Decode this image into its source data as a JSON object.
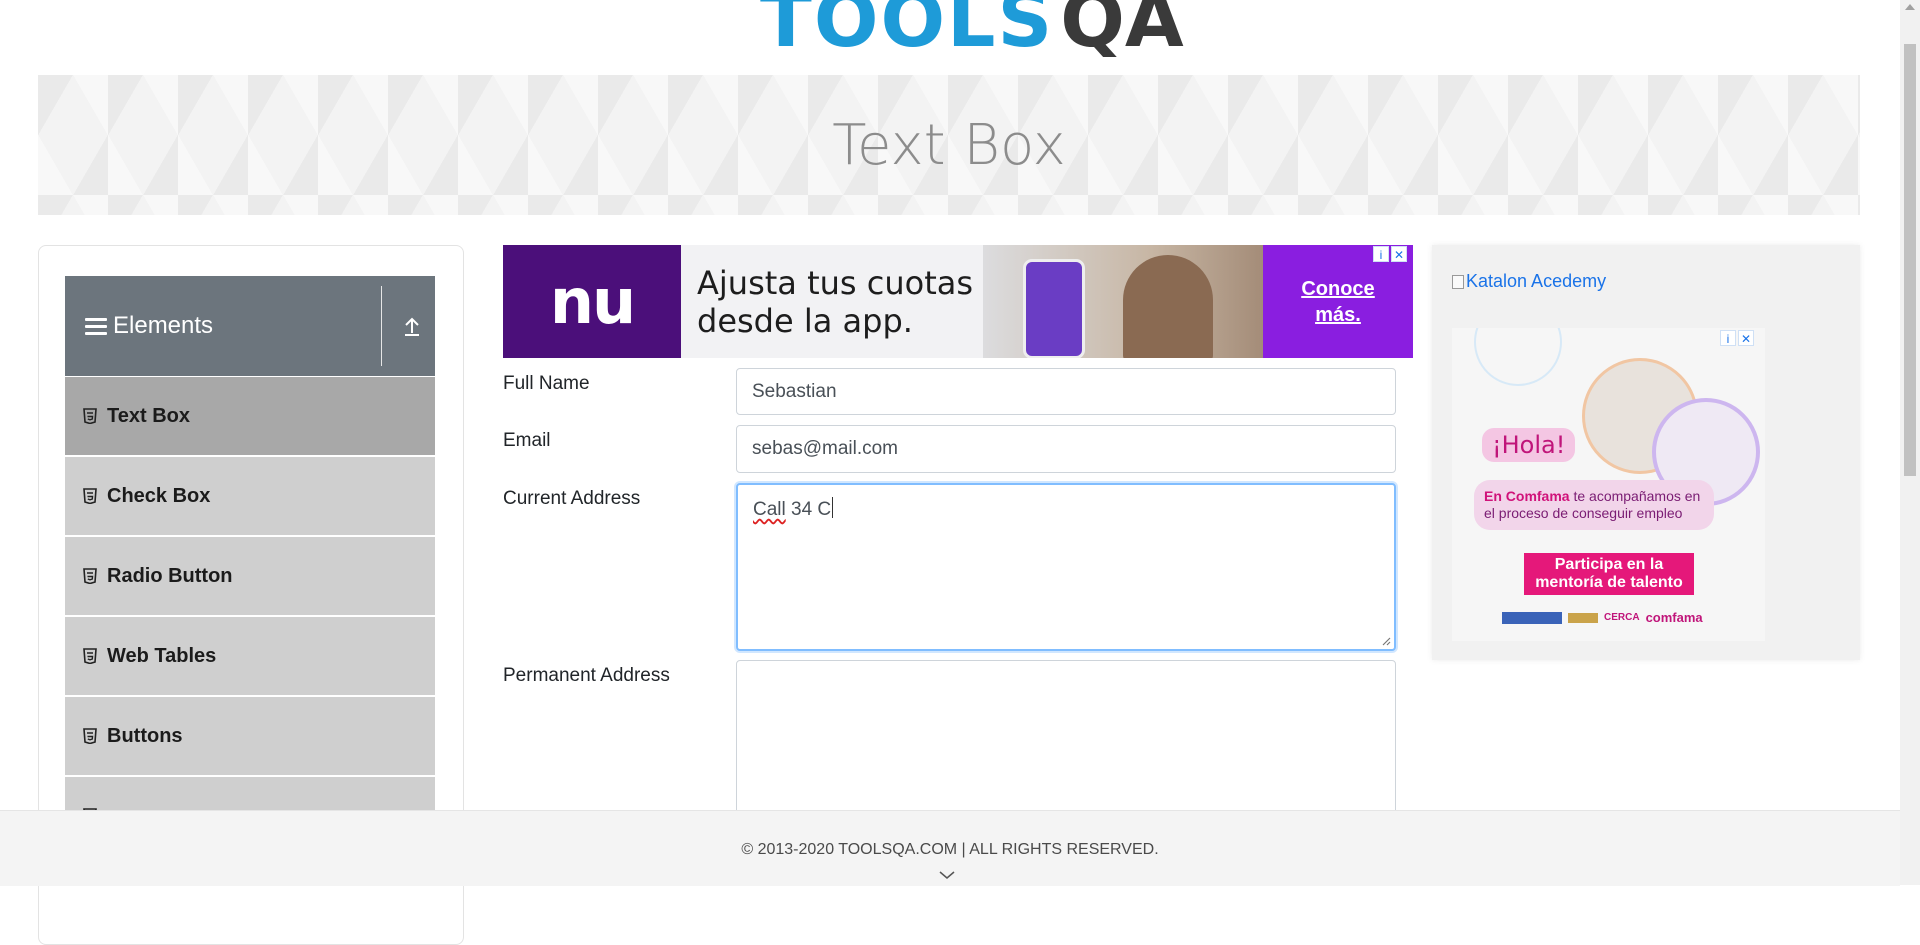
{
  "header": {
    "logo_text": "TOOLS",
    "logo_text_2": "QA",
    "page_title": "Text Box"
  },
  "sidebar": {
    "group_title": "Elements",
    "items": [
      {
        "label": "Text Box",
        "active": true
      },
      {
        "label": "Check Box"
      },
      {
        "label": "Radio Button"
      },
      {
        "label": "Web Tables"
      },
      {
        "label": "Buttons"
      }
    ]
  },
  "ad_top": {
    "brand": "nu",
    "message_line1": "Ajusta tus cuotas",
    "message_line2": "desde la app.",
    "cta_line1": "Conoce",
    "cta_line2": "más."
  },
  "form": {
    "full_name_label": "Full Name",
    "full_name_value": "Sebastian",
    "email_label": "Email",
    "email_value": "sebas@mail.com",
    "current_address_label": "Current Address",
    "current_address_word1": "Call",
    "current_address_rest": " 34 C",
    "permanent_address_label": "Permanent Address",
    "permanent_address_value": ""
  },
  "ad_right": {
    "alt_text": "Katalon Acedemy",
    "greeting": "¡Hola!",
    "body_bold": "En Comfama",
    "body_rest": " te acompañamos en el proceso de conseguir empleo",
    "button_line1": "Participa en la",
    "button_line2": "mentoría de talento",
    "brand": "comfama",
    "sponsor_label": "CERCA"
  },
  "footer": {
    "copyright": "© 2013-2020 TOOLSQA.COM | ALL RIGHTS RESERVED."
  },
  "colors": {
    "accent": "#1e9bd8",
    "header_gray": "#6c757d",
    "active_item": "#a8a8a8",
    "item": "#cfcfcf",
    "focus": "#80bdff",
    "nu_purple": "#4b0f7a"
  }
}
